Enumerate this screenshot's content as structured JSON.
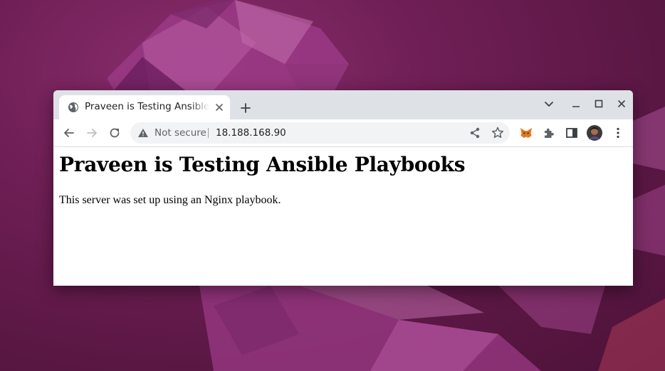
{
  "browser": {
    "tab": {
      "title": "Praveen is Testing Ansible Playbooks"
    },
    "address_bar": {
      "security_label": "Not secure",
      "url": "18.188.168.90"
    }
  },
  "page": {
    "heading": "Praveen is Testing Ansible Playbooks",
    "body_text": "This server was set up using an Nginx playbook."
  },
  "colors": {
    "tabstrip": "#dee1e6",
    "omnibox": "#f1f3f4",
    "wallpaper": "#6f1f55"
  },
  "icons": [
    "globe-icon",
    "close-icon",
    "plus-icon",
    "chevron-down-icon",
    "minimize-icon",
    "maximize-icon",
    "window-close-icon",
    "back-arrow-icon",
    "forward-arrow-icon",
    "reload-icon",
    "warning-icon",
    "share-icon",
    "star-icon",
    "metamask-fox-icon",
    "puzzle-icon",
    "side-panel-icon",
    "avatar",
    "kebab-menu-icon"
  ]
}
